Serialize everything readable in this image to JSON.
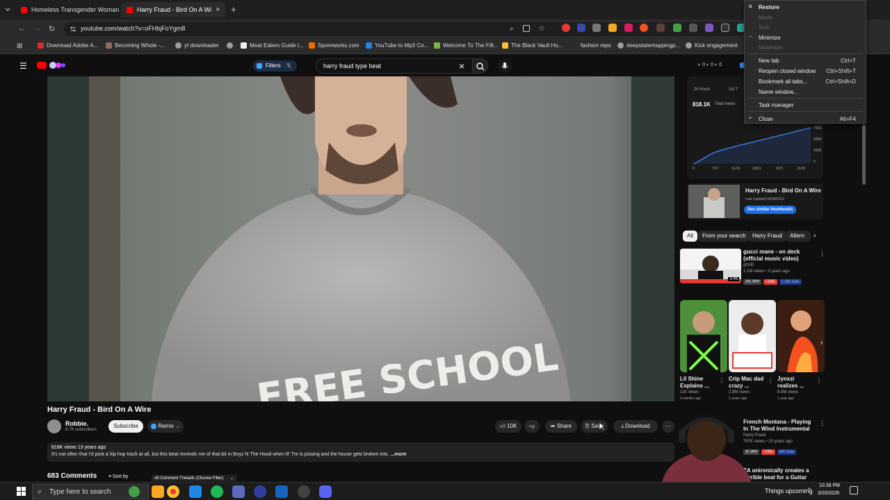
{
  "browser": {
    "tabs": [
      {
        "title": "Homeless Transgender Woman",
        "close": "×"
      },
      {
        "title": "Harry Fraud - Bird On A Wi",
        "close": "×"
      }
    ],
    "new_tab": "+",
    "url": "youtube.com/watch?v=oFHbjFoYgm8",
    "bookmarks": [
      "Download Adobe A...",
      "Becoming Whole -...",
      "yt downloader",
      "Meat Eaters Guide t...",
      "Sporeworks.com",
      "YouTube to Mp3 Co...",
      "Welcome To The Fift...",
      "The Black Vault Ho...",
      "fashion reps",
      "deepstatemappingp...",
      "Kick engagement"
    ]
  },
  "context_menu": {
    "items": [
      {
        "label": "Restore",
        "key": "",
        "disabled": false,
        "bold": true
      },
      {
        "label": "Move",
        "key": "",
        "disabled": true
      },
      {
        "label": "Size",
        "key": "",
        "disabled": true
      },
      {
        "label": "Minimize",
        "key": "",
        "disabled": false
      },
      {
        "label": "Maximize",
        "key": "",
        "disabled": true
      },
      {
        "label": "New tab",
        "key": "Ctrl+T",
        "disabled": false
      },
      {
        "label": "Reopen closed window",
        "key": "Ctrl+Shift+T",
        "disabled": false
      },
      {
        "label": "Bookmark all tabs...",
        "key": "Ctrl+Shift+D",
        "disabled": false
      },
      {
        "label": "Name window...",
        "key": "",
        "disabled": false
      },
      {
        "label": "Task manager",
        "key": "",
        "disabled": false
      },
      {
        "label": "Close",
        "key": "Alt+F4",
        "disabled": false
      }
    ]
  },
  "youtube": {
    "filters_label": "Filters",
    "search_query": "harry fraud type beat",
    "search_clear": "×",
    "video_title": "Harry Fraud - Bird On A Wire",
    "channel_name": "Robbie.",
    "subscribers": "8.7K subscribers",
    "subscribe_label": "Subscribe",
    "remix_label": "Remix",
    "likes": "10K",
    "share_label": "Share",
    "save_label": "Save",
    "download_label": "Download",
    "more_label": "···",
    "desc_meta": "818K views  13 years ago",
    "desc_text": "It's not often that I'd post a hip hop track at all, but this beat reminds me of that bit in Boyz N The Hood when lil' Tre is pissing and the house gets broken into.",
    "desc_more": "...more",
    "comments_count": "683 Comments",
    "sort_by": "Sort by",
    "comment_filter": "All Comment Threads (Choose Filter)"
  },
  "analytics": {
    "hours_label": "24 hours",
    "first_label": "1st 7",
    "total_views": "818.1K",
    "total_views_label": "Total views",
    "y_ticks": [
      "750K",
      "500K",
      "250K",
      "0"
    ],
    "x_ticks": [
      "0",
      "7/17",
      "11/19",
      "10/21",
      "8/23",
      "11/25"
    ],
    "thumb_title": "Harry Fraud - Bird On A Wire",
    "thumb_date": "Last Updated 04/28/2012",
    "similar_label": "See similar thumbnails"
  },
  "chips": [
    "All",
    "From your search",
    "Harry Fraud",
    "Altern"
  ],
  "recommended": {
    "title": "gucci mane - on deck (official music video)",
    "channel": "g0rd0",
    "meta": "1.1M views • 3 years ago",
    "duration": "3:46",
    "badge1": "241 VPH",
    "badge2": "×100x",
    "badge3": "2.33K Subs"
  },
  "shorts": [
    {
      "title": "Lil Shine Explains ...",
      "views": "11K views",
      "age": "3 months ago"
    },
    {
      "title": "Crip Mac dad crazy ...",
      "views": "2.8M views",
      "age": "2 years ago"
    },
    {
      "title": "Jynxzi realizes ...",
      "views": "8.9M views",
      "age": "1 year ago"
    }
  ],
  "rec2": {
    "title": "French Montana - Playing In The Wind Instrumental",
    "channel": "Harry Fraud",
    "meta": "767K views • 15 years ago",
    "badge1": "11 VPH",
    "badge2": "×100x",
    "badge3": "43K Subs"
  },
  "rec3": {
    "title": "ZA unironically creates a terrible beat for a Guitar Cente..."
  },
  "taskbar": {
    "search_placeholder": "Type here to search",
    "things_upcoming": "Things upcoming",
    "time": "10:38 PM",
    "date": "3/20/2026"
  },
  "colors": {
    "accent_blue": "#3ea6ff",
    "yt_red": "#ff0000",
    "chart_line": "#3b82f6"
  }
}
